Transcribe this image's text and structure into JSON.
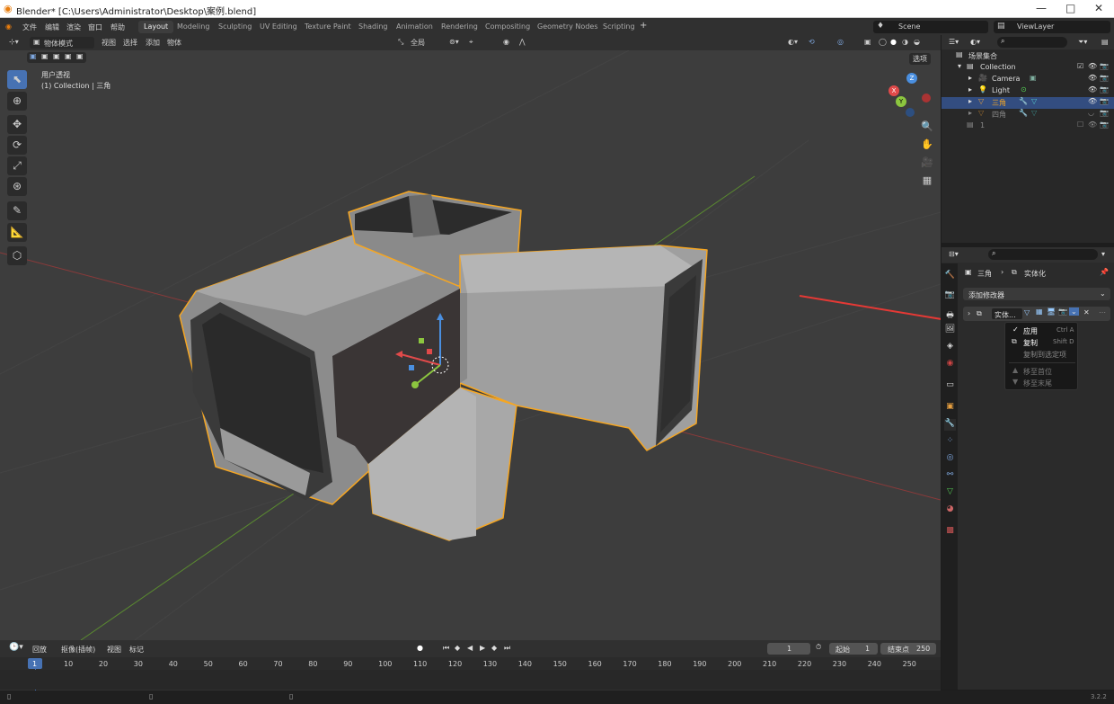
{
  "window": {
    "title": "Blender* [C:\\Users\\Administrator\\Desktop\\案例.blend]",
    "minimize": "—",
    "maximize": "□",
    "close": "✕"
  },
  "menu": {
    "items": [
      "文件",
      "编辑",
      "渲染",
      "窗口",
      "帮助"
    ]
  },
  "workspaces": [
    {
      "label": "Layout",
      "active": true
    },
    {
      "label": "Modeling"
    },
    {
      "label": "Sculpting"
    },
    {
      "label": "UV Editing"
    },
    {
      "label": "Texture Paint"
    },
    {
      "label": "Shading"
    },
    {
      "label": "Animation"
    },
    {
      "label": "Rendering"
    },
    {
      "label": "Compositing"
    },
    {
      "label": "Geometry Nodes"
    },
    {
      "label": "Scripting"
    }
  ],
  "add_workspace": "+",
  "scene": {
    "label": "Scene"
  },
  "view_layer": {
    "label": "ViewLayer"
  },
  "viewport_header": {
    "mode": "物体模式",
    "menus": [
      "视图",
      "选择",
      "添加",
      "物体"
    ],
    "orientation": "全局",
    "options": "选项"
  },
  "viewport": {
    "perspective": "用户透视",
    "collection_info": "(1) Collection | 三角"
  },
  "gizmo": {
    "x": "X",
    "y": "Y",
    "z": "Z"
  },
  "outliner": {
    "root": "场景集合",
    "rows": [
      {
        "label": "Collection"
      },
      {
        "label": "Camera"
      },
      {
        "label": "Light"
      },
      {
        "label": "三角",
        "selected": true
      },
      {
        "label": "四角"
      },
      {
        "label": "1"
      }
    ]
  },
  "properties": {
    "breadcrumb": {
      "object": "三角",
      "modifier": "实体化"
    },
    "add_modifier": "添加修改器",
    "modifier_name": "实体..."
  },
  "context_menu": {
    "items": [
      {
        "label": "应用",
        "shortcut": "Ctrl A",
        "check": "✓"
      },
      {
        "label": "复制",
        "shortcut": "Shift D"
      },
      {
        "label": "复制到选定项"
      },
      {
        "label": "移至首位",
        "disabled": true
      },
      {
        "label": "移至末尾",
        "disabled": true
      }
    ]
  },
  "timeline": {
    "menus": [
      "回放",
      "抠像(插帧)",
      "视图",
      "标记"
    ],
    "current_frame": "1",
    "start_label": "起始",
    "start": "1",
    "end_label": "结束点",
    "end": "250",
    "ticks": [
      "1",
      "10",
      "20",
      "30",
      "40",
      "50",
      "60",
      "70",
      "80",
      "90",
      "100",
      "110",
      "120",
      "130",
      "140",
      "150",
      "160",
      "170",
      "180",
      "190",
      "200",
      "210",
      "220",
      "230",
      "240",
      "250"
    ]
  },
  "status": {
    "version": "3.2.2"
  },
  "colors": {
    "accent": "#4772b3",
    "selection": "#f5a623",
    "viewport_bg": "#3d3d3d",
    "arrow": "#e53935"
  }
}
